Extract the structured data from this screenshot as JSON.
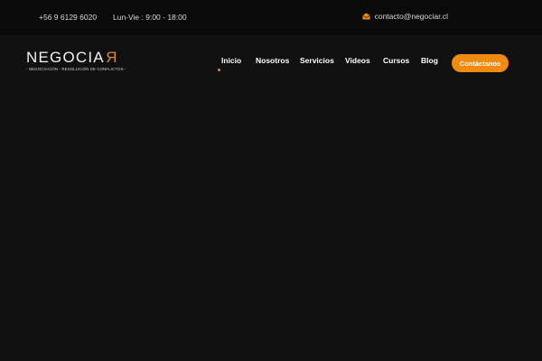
{
  "topbar": {
    "phone": "+56 9 6129 6020",
    "hours": "Lun-Vie : 9:00 - 18:00",
    "email": "contacto@negociar.cl",
    "email_icon": "envelope-icon"
  },
  "logo": {
    "word_main": "NEGOCIA",
    "word_last": "R",
    "tagline": "- NEGOCIACIÓN - RESOLUCIÓN DE CONFLICTOS -"
  },
  "nav": {
    "items": [
      {
        "label": "Inicio",
        "active": true
      },
      {
        "label": "Nosotros"
      },
      {
        "label": "Servicios"
      },
      {
        "label": "Videos"
      },
      {
        "label": "Cursos"
      },
      {
        "label": "Blog"
      }
    ],
    "cta_label": "Contáctanos"
  },
  "colors": {
    "accent": "#f08a11",
    "background": "#111111",
    "topbar": "#0a0a0a"
  }
}
